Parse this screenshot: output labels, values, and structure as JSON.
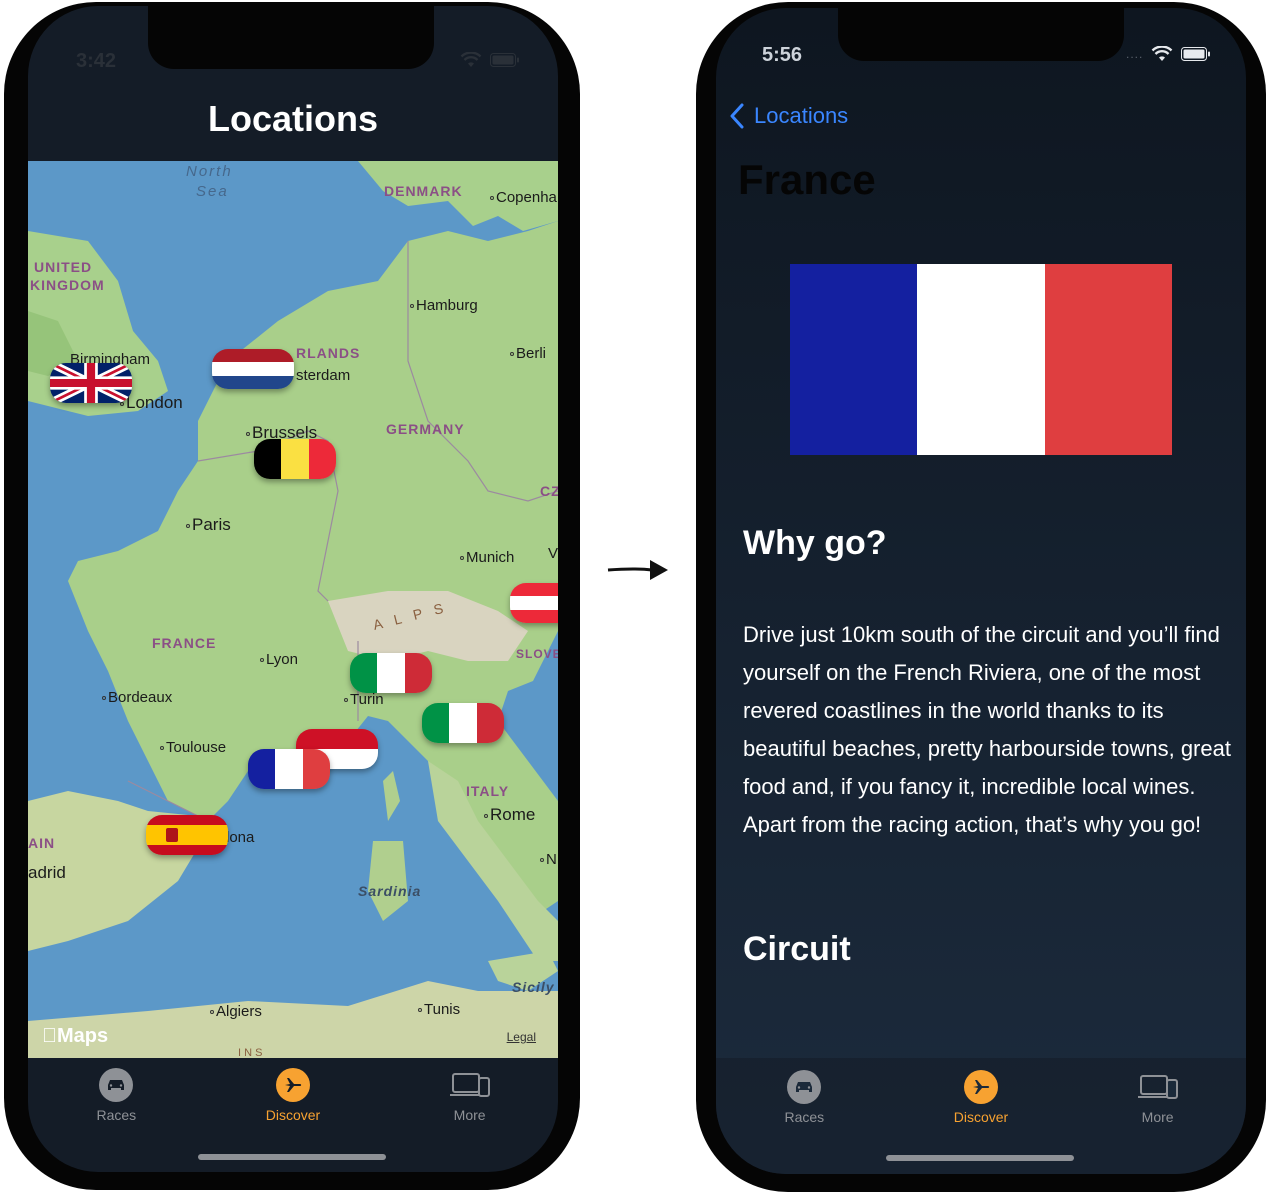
{
  "left_screen": {
    "status_time": "3:42",
    "nav_title": "Locations",
    "map_labels": {
      "north_sea": "North",
      "north_sea_2": "Sea",
      "denmark": "DENMARK",
      "copenhagen": "Copenha",
      "united": "UNITED",
      "kingdom": "KINGDOM",
      "hamburg": "Hamburg",
      "birmingham": "Birmingham",
      "netherlands": "RLANDS",
      "amsterdam": "sterdam",
      "berlin": "Berli",
      "london": "London",
      "brussels": "Brussels",
      "germany": "GERMANY",
      "cz": "CZ",
      "paris": "Paris",
      "munich": "Munich",
      "v": "V",
      "alps": "ALPS",
      "france": "FRANCE",
      "lyon": "Lyon",
      "slov": "SLOVE",
      "bordeaux": "Bordeaux",
      "turin": "Turin",
      "toulouse": "Toulouse",
      "italy": "ITALY",
      "rome": "Rome",
      "barcelona": "lona",
      "ain": "AIN",
      "madrid": "adrid",
      "n": "N",
      "sardinia": "Sardinia",
      "sicily": "Sicily",
      "algiers": "Algiers",
      "tunis": "Tunis",
      "ins": "I N S"
    },
    "maps_logo": "Maps",
    "legal": "Legal"
  },
  "tabs": [
    {
      "label": "Races",
      "icon": "car-icon"
    },
    {
      "label": "Discover",
      "icon": "airplane-icon"
    },
    {
      "label": "More",
      "icon": "devices-icon"
    }
  ],
  "right_screen": {
    "status_time": "5:56",
    "back_label": "Locations",
    "title": "France",
    "section_why": "Why go?",
    "why_text": "Drive just 10km south of the circuit and you’ll find yourself on the French Riviera, one of the most revered coastlines in the world thanks to its beautiful beaches, pretty harbourside towns, great food and, if you fancy it, incredible local wines. Apart from the racing action, that’s why you go!",
    "section_circuit": "Circuit"
  },
  "colors": {
    "accent": "#f7a231",
    "tab_inactive": "#8e9196",
    "link": "#3a86ff",
    "france_blue": "#1420a0",
    "france_white": "#ffffff",
    "france_red": "#df3e40"
  }
}
